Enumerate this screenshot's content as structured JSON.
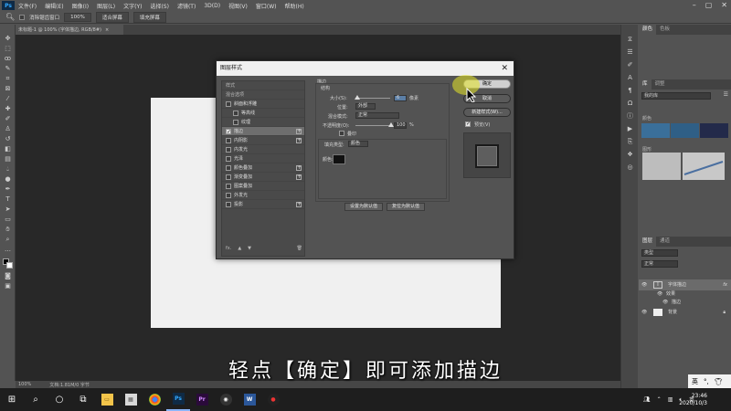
{
  "app": {
    "logo": "Ps",
    "menus": [
      "文件(F)",
      "编辑(E)",
      "图像(I)",
      "图层(L)",
      "文字(Y)",
      "选择(S)",
      "滤镜(T)",
      "3D(D)",
      "视图(V)",
      "窗口(W)",
      "帮助(H)"
    ]
  },
  "options_bar": {
    "checkbox_label": "消除锯齿窗口",
    "zoom": "100%",
    "fit_screen": "适合屏幕",
    "fill_screen": "填充屏幕"
  },
  "document": {
    "tab_title": "未标题-1 @ 100% (字体描边, RGB/8#)"
  },
  "status_bar": {
    "zoom": "100%",
    "doc_size": "文档:1.81M/0 字节"
  },
  "right_panel": {
    "tabs_top": [
      "颜色",
      "色板"
    ],
    "tabs_mid": [
      "库",
      "调整"
    ],
    "library_select": "我的库",
    "section_colors": "颜色",
    "section_presets": "图形",
    "tabs_layers": [
      "图层",
      "通道"
    ],
    "layers_search": "类型",
    "layers_mode": "正常",
    "layer_text": "字体描边",
    "layer_effect": "效果",
    "layer_effect_stroke": "描边",
    "layer_bg": "背景",
    "swatch_colors": [
      "#3a6f9a",
      "#2f5f86",
      "#232a4a"
    ]
  },
  "dialog": {
    "title": "图层样式",
    "close": "✕",
    "style_list": {
      "header1": "样式",
      "header2": "混合选项",
      "items": [
        {
          "label": "斜面和浮雕",
          "checked": false,
          "plus": false
        },
        {
          "label": "等高线",
          "checked": false,
          "plus": false
        },
        {
          "label": "纹理",
          "checked": false,
          "plus": false
        },
        {
          "label": "描边",
          "checked": true,
          "plus": true
        },
        {
          "label": "内阴影",
          "checked": false,
          "plus": true
        },
        {
          "label": "内发光",
          "checked": false,
          "plus": false
        },
        {
          "label": "光泽",
          "checked": false,
          "plus": false
        },
        {
          "label": "颜色叠加",
          "checked": false,
          "plus": true
        },
        {
          "label": "渐变叠加",
          "checked": false,
          "plus": true
        },
        {
          "label": "图案叠加",
          "checked": false,
          "plus": false
        },
        {
          "label": "外发光",
          "checked": false,
          "plus": false
        },
        {
          "label": "投影",
          "checked": false,
          "plus": true
        }
      ],
      "footer_fx": "fx."
    },
    "stroke": {
      "section_title": "描边",
      "structure": "结构",
      "size_label": "大小(S):",
      "size_value": "6",
      "size_unit": "像素",
      "position_label": "位置:",
      "position_value": "外部",
      "blend_label": "混合模式:",
      "blend_value": "正常",
      "opacity_label": "不透明度(O):",
      "opacity_value": "100",
      "opacity_unit": "%",
      "overprint": "叠印",
      "fill_type_label": "填充类型:",
      "fill_type_value": "颜色",
      "color_label": "颜色:",
      "stroke_color": "#111111",
      "set_default": "设置为默认值",
      "reset_default": "复位为默认值"
    },
    "buttons": {
      "ok": "确定",
      "cancel": "取消",
      "new_style": "新建样式(W)...",
      "preview": "预览(V)"
    }
  },
  "subtitle": "轻点【确定】即可添加描边",
  "taskbar": {
    "tray_text": "英",
    "ime_text": "英",
    "date": "2020/10/3",
    "time": "23:46"
  }
}
